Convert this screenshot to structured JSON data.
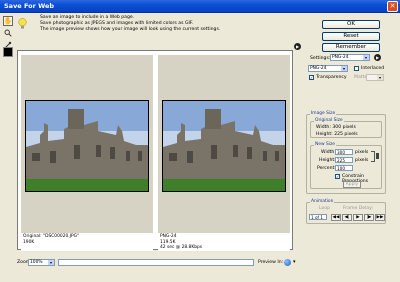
{
  "window": {
    "title": "Save For Web",
    "close_glyph": "✕"
  },
  "tools": [
    {
      "name": "hand-tool-icon",
      "glyph": "✋"
    },
    {
      "name": "zoom-tool-icon",
      "glyph": "🔍"
    },
    {
      "name": "eyedropper-tool-icon",
      "glyph": "✐"
    }
  ],
  "info": {
    "lines": [
      "Save an image to include in a Web page.",
      "Save photographic as JPEGS and images with limited colors as GIF.",
      "The image preview shows how your image will look using the current settings."
    ]
  },
  "buttons": {
    "ok": "OK",
    "reset": "Reset",
    "remember": "Remember"
  },
  "preview": {
    "original": {
      "line1": "Original: \"DSC00020.JPG\"",
      "line2": "190K"
    },
    "optimized": {
      "line1": "PNG-24",
      "line2": "119.5K",
      "line3": "42 sec @ 28.8Kbps"
    }
  },
  "settings": {
    "label": "Settings:",
    "preset": "PNG-24",
    "format": "PNG-24",
    "interlaced_label": "Interlaced",
    "interlaced": false,
    "transparency_label": "Transparency",
    "transparency": true,
    "matte_label": "Matte:"
  },
  "image_size": {
    "title": "Image Size",
    "original": {
      "title": "Original Size",
      "width": "Width:  300 pixels",
      "height": "Height:  225 pixels"
    },
    "new": {
      "title": "New Size",
      "width_label": "Width:",
      "width_value": "300",
      "height_label": "Height:",
      "height_value": "225",
      "percent_label": "Percent:",
      "percent_value": "100",
      "unit": "pixels",
      "constrain_label": "Constrain Proportions",
      "constrain": true,
      "apply": "Apply"
    }
  },
  "animation": {
    "title": "Animation",
    "loop_label": "Loop",
    "frame_delay_label": "Frame Delay:",
    "frame_counter": "1 of 1",
    "controls": [
      "◀◀",
      "◀|",
      "▶",
      "|▶",
      "▶▶"
    ]
  },
  "bottom": {
    "zoom_label": "Zoom:",
    "zoom_value": "100%",
    "preview_in_label": "Preview In:"
  },
  "colors": {
    "titlebar": "#0a4fd6",
    "dialog_bg": "#ece9d8",
    "group_title": "#1c3a8c"
  }
}
